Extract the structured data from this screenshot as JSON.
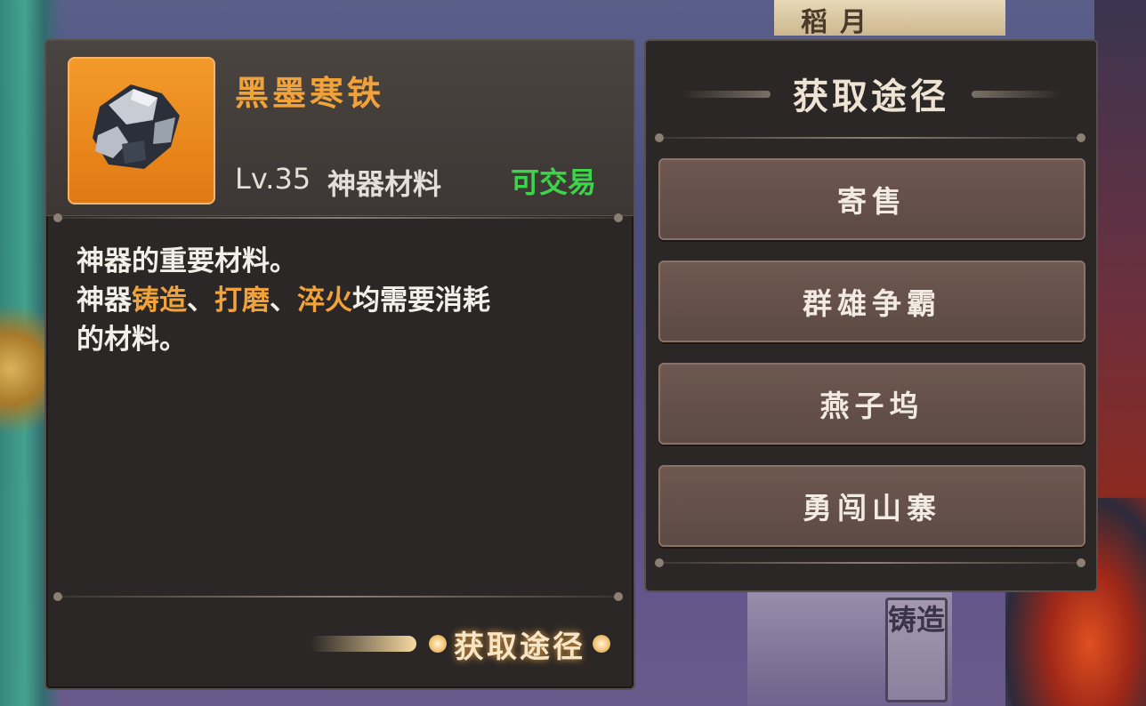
{
  "item": {
    "name": "黑墨寒铁",
    "level": "Lv.35",
    "type": "神器材料",
    "tradable": "可交易",
    "icon": "ore-icon"
  },
  "description": {
    "line1": "神器的重要材料。",
    "line2_parts": [
      "神器",
      "铸造",
      "、",
      "打磨",
      "、",
      "淬火",
      "均需要消耗"
    ],
    "line3": "的材料。"
  },
  "obtain_link_label": "获取途径",
  "sources": {
    "title": "获取途径",
    "items": [
      "寄售",
      "群雄争霸",
      "燕子坞",
      "勇闯山寨"
    ]
  },
  "background": {
    "stamp_text": "铸造",
    "top_glyphs": "稻月"
  },
  "colors": {
    "name": "#f1a33a",
    "tradable": "#3cd44a",
    "highlight": "#f1a33a",
    "panel": "#2b2726"
  }
}
